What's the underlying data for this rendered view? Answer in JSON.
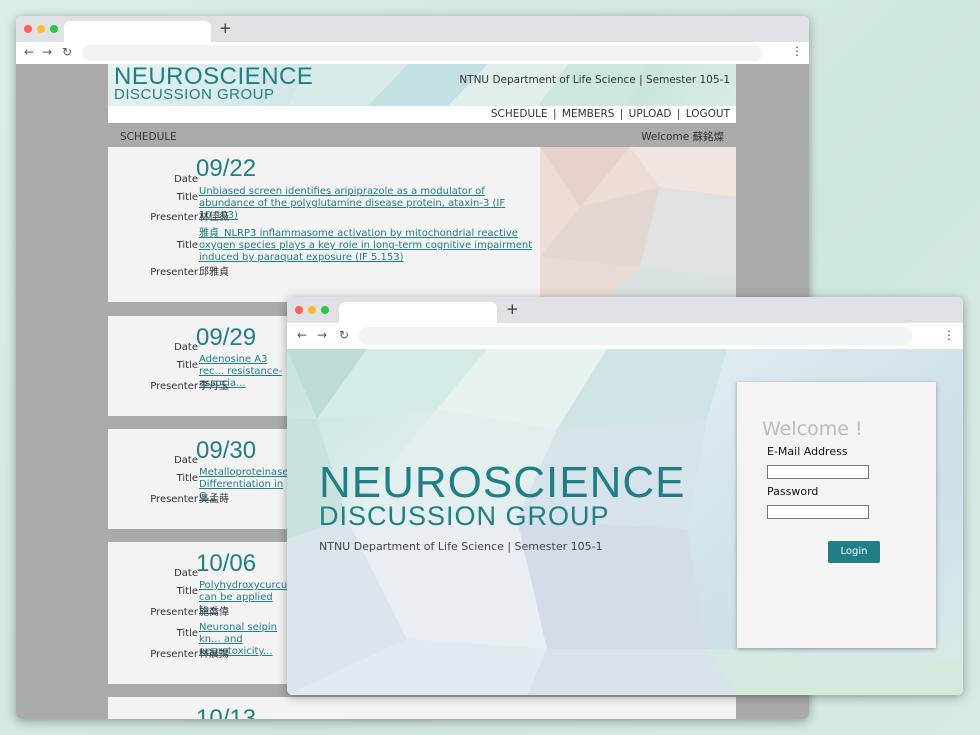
{
  "browser": {
    "new_tab_label": "+",
    "back_label": "←",
    "forward_label": "→",
    "reload_label": "↻",
    "menu_label": "⋮",
    "dot_colors": [
      "#ff5f57",
      "#febc2e",
      "#28c840"
    ]
  },
  "site": {
    "logo_line1": "NEUROSCIENCE",
    "logo_line2": "DISCUSSION GROUP",
    "affiliation": "NTNU Department of Life Science  |  Semester 105-1",
    "accent_color": "#1f7e86",
    "menu": [
      "SCHEDULE",
      "MEMBERS",
      "UPLOAD",
      "LOGOUT"
    ],
    "menu_separator": "|",
    "section_title": "SCHEDULE",
    "welcome_user": "Welcome 蘇銘燦"
  },
  "labels": {
    "date": "Date",
    "title": "Title",
    "presenter": "Presenter"
  },
  "schedule": [
    {
      "date": "09/22",
      "talks": [
        {
          "title": "Unbiased screen identifies aripiprazole as a modulator of abundance of the polyglutamine disease protein, ataxin-3 (IF 10.103)",
          "presenter": "林佳薇"
        },
        {
          "title": "雅貞_NLRP3 inflammasome activation by mitochondrial reactive oxygen species plays a key role in long-term cognitive impairment induced by paraquat exposure (IF 5.153)",
          "presenter": "邱雅貞"
        }
      ]
    },
    {
      "date": "09/29",
      "talks": [
        {
          "title": "Adenosine A3 rec... resistance-associa...",
          "presenter": "李丹玉"
        }
      ]
    },
    {
      "date": "09/30",
      "talks": [
        {
          "title": "Metalloproteinase... Differentiation in G...",
          "presenter": "吳孟蒔"
        }
      ]
    },
    {
      "date": "10/06",
      "talks": [
        {
          "title": "Polyhydroxycurcu... can be applied to...",
          "presenter": "施喬偉"
        },
        {
          "title": "Neuronal seipin kn... and neurotoxicity...",
          "presenter": "林晨揚"
        }
      ]
    },
    {
      "date": "10/13",
      "talks": []
    }
  ],
  "login_page": {
    "logo_line1": "NEUROSCIENCE",
    "logo_line2": "DISCUSSION GROUP",
    "affiliation": "NTNU Department of Life Science  |  Semester 105-1",
    "welcome": "Welcome !",
    "email_label": "E-Mail Address",
    "password_label": "Password",
    "email_value": "",
    "password_value": "",
    "login_button": "Login"
  }
}
